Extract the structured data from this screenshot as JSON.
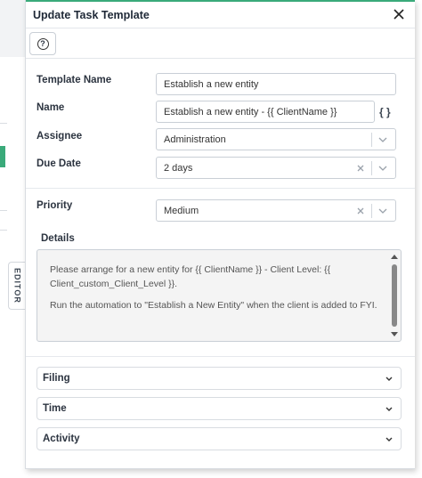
{
  "background": {
    "editor_tab_label": "EDITOR"
  },
  "dialog": {
    "title": "Update Task Template",
    "close_icon": "close-icon",
    "help_icon": "question-circle-icon"
  },
  "form": {
    "template_name": {
      "label": "Template Name",
      "value": "Establish a new entity"
    },
    "name": {
      "label": "Name",
      "value": "Establish a new entity - {{ ClientName }}",
      "braces": "{ }"
    },
    "assignee": {
      "label": "Assignee",
      "value": "Administration"
    },
    "due_date": {
      "label": "Due Date",
      "value": "2 days"
    },
    "priority": {
      "label": "Priority",
      "value": "Medium"
    },
    "details": {
      "label": "Details",
      "paragraph_1": "Please arrange for a new entity for {{ ClientName }} - Client Level: {{ Client_custom_Client_Level }}.",
      "paragraph_2": "Run the automation to \"Establish a New Entity\" when the client is added to FYI."
    }
  },
  "sections": [
    {
      "label": "Filing"
    },
    {
      "label": "Time"
    },
    {
      "label": "Activity"
    }
  ],
  "colors": {
    "accent": "#3aaa7a",
    "border": "#c9cfd6",
    "text": "#2c3440"
  }
}
